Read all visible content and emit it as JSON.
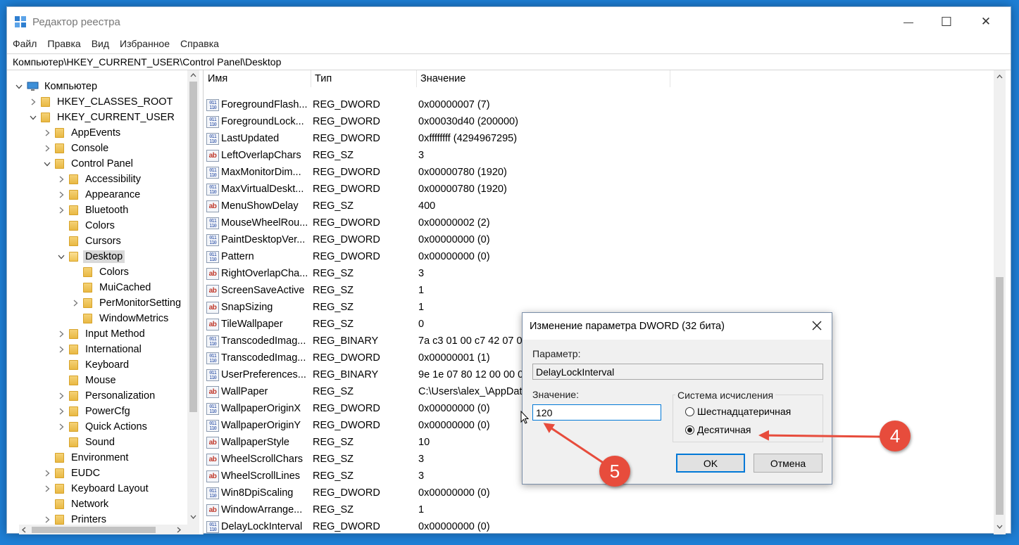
{
  "window": {
    "title": "Редактор реестра",
    "minimize_glyph": "—",
    "maximize_glyph": "☐",
    "close_glyph": "✕"
  },
  "menu": [
    "Файл",
    "Правка",
    "Вид",
    "Избранное",
    "Справка"
  ],
  "address": "Компьютер\\HKEY_CURRENT_USER\\Control Panel\\Desktop",
  "tree": [
    {
      "label": "Компьютер",
      "level": 0,
      "expander": "v",
      "icon": "computer-icon"
    },
    {
      "label": "HKEY_CLASSES_ROOT",
      "level": 1,
      "expander": ">",
      "icon": "folder-icon"
    },
    {
      "label": "HKEY_CURRENT_USER",
      "level": 1,
      "expander": "v",
      "icon": "folder-icon"
    },
    {
      "label": "AppEvents",
      "level": 2,
      "expander": ">",
      "icon": "folder-icon"
    },
    {
      "label": "Console",
      "level": 2,
      "expander": ">",
      "icon": "folder-icon"
    },
    {
      "label": "Control Panel",
      "level": 2,
      "expander": "v",
      "icon": "folder-icon"
    },
    {
      "label": "Accessibility",
      "level": 3,
      "expander": ">",
      "icon": "folder-icon"
    },
    {
      "label": "Appearance",
      "level": 3,
      "expander": ">",
      "icon": "folder-icon"
    },
    {
      "label": "Bluetooth",
      "level": 3,
      "expander": ">",
      "icon": "folder-icon"
    },
    {
      "label": "Colors",
      "level": 3,
      "expander": "",
      "icon": "folder-icon"
    },
    {
      "label": "Cursors",
      "level": 3,
      "expander": "",
      "icon": "folder-icon"
    },
    {
      "label": "Desktop",
      "level": 3,
      "expander": "v",
      "icon": "folder-open-icon",
      "selected": true
    },
    {
      "label": "Colors",
      "level": 4,
      "expander": "",
      "icon": "folder-icon"
    },
    {
      "label": "MuiCached",
      "level": 4,
      "expander": "",
      "icon": "folder-icon"
    },
    {
      "label": "PerMonitorSetting",
      "level": 4,
      "expander": ">",
      "icon": "folder-icon"
    },
    {
      "label": "WindowMetrics",
      "level": 4,
      "expander": "",
      "icon": "folder-icon"
    },
    {
      "label": "Input Method",
      "level": 3,
      "expander": ">",
      "icon": "folder-icon"
    },
    {
      "label": "International",
      "level": 3,
      "expander": ">",
      "icon": "folder-icon"
    },
    {
      "label": "Keyboard",
      "level": 3,
      "expander": "",
      "icon": "folder-icon"
    },
    {
      "label": "Mouse",
      "level": 3,
      "expander": "",
      "icon": "folder-icon"
    },
    {
      "label": "Personalization",
      "level": 3,
      "expander": ">",
      "icon": "folder-icon"
    },
    {
      "label": "PowerCfg",
      "level": 3,
      "expander": ">",
      "icon": "folder-icon"
    },
    {
      "label": "Quick Actions",
      "level": 3,
      "expander": ">",
      "icon": "folder-icon"
    },
    {
      "label": "Sound",
      "level": 3,
      "expander": "",
      "icon": "folder-icon"
    },
    {
      "label": "Environment",
      "level": 2,
      "expander": "",
      "icon": "folder-icon"
    },
    {
      "label": "EUDC",
      "level": 2,
      "expander": ">",
      "icon": "folder-icon"
    },
    {
      "label": "Keyboard Layout",
      "level": 2,
      "expander": ">",
      "icon": "folder-icon"
    },
    {
      "label": "Network",
      "level": 2,
      "expander": "",
      "icon": "folder-icon"
    },
    {
      "label": "Printers",
      "level": 2,
      "expander": ">",
      "icon": "folder-icon"
    }
  ],
  "columns": {
    "name": "Имя",
    "type": "Тип",
    "value": "Значение"
  },
  "values": [
    {
      "icon": "dword",
      "name": "ForegroundFlash...",
      "type": "REG_DWORD",
      "data": "0x00000007 (7)"
    },
    {
      "icon": "dword",
      "name": "ForegroundLock...",
      "type": "REG_DWORD",
      "data": "0x00030d40 (200000)"
    },
    {
      "icon": "dword",
      "name": "LastUpdated",
      "type": "REG_DWORD",
      "data": "0xffffffff (4294967295)"
    },
    {
      "icon": "sz",
      "name": "LeftOverlapChars",
      "type": "REG_SZ",
      "data": "3"
    },
    {
      "icon": "dword",
      "name": "MaxMonitorDim...",
      "type": "REG_DWORD",
      "data": "0x00000780 (1920)"
    },
    {
      "icon": "dword",
      "name": "MaxVirtualDeskt...",
      "type": "REG_DWORD",
      "data": "0x00000780 (1920)"
    },
    {
      "icon": "sz",
      "name": "MenuShowDelay",
      "type": "REG_SZ",
      "data": "400"
    },
    {
      "icon": "dword",
      "name": "MouseWheelRou...",
      "type": "REG_DWORD",
      "data": "0x00000002 (2)"
    },
    {
      "icon": "dword",
      "name": "PaintDesktopVer...",
      "type": "REG_DWORD",
      "data": "0x00000000 (0)"
    },
    {
      "icon": "dword",
      "name": "Pattern",
      "type": "REG_DWORD",
      "data": "0x00000000 (0)"
    },
    {
      "icon": "sz",
      "name": "RightOverlapCha...",
      "type": "REG_SZ",
      "data": "3"
    },
    {
      "icon": "sz",
      "name": "ScreenSaveActive",
      "type": "REG_SZ",
      "data": "1"
    },
    {
      "icon": "sz",
      "name": "SnapSizing",
      "type": "REG_SZ",
      "data": "1"
    },
    {
      "icon": "sz",
      "name": "TileWallpaper",
      "type": "REG_SZ",
      "data": "0"
    },
    {
      "icon": "dword",
      "name": "TranscodedImag...",
      "type": "REG_BINARY",
      "data": "7a c3 01 00 c7 42 07 00"
    },
    {
      "icon": "dword",
      "name": "TranscodedImag...",
      "type": "REG_DWORD",
      "data": "0x00000001 (1)"
    },
    {
      "icon": "dword",
      "name": "UserPreferences...",
      "type": "REG_BINARY",
      "data": "9e 1e 07 80 12 00 00 00"
    },
    {
      "icon": "sz",
      "name": "WallPaper",
      "type": "REG_SZ",
      "data": "C:\\Users\\alex_\\AppDat"
    },
    {
      "icon": "dword",
      "name": "WallpaperOriginX",
      "type": "REG_DWORD",
      "data": "0x00000000 (0)"
    },
    {
      "icon": "dword",
      "name": "WallpaperOriginY",
      "type": "REG_DWORD",
      "data": "0x00000000 (0)"
    },
    {
      "icon": "sz",
      "name": "WallpaperStyle",
      "type": "REG_SZ",
      "data": "10"
    },
    {
      "icon": "sz",
      "name": "WheelScrollChars",
      "type": "REG_SZ",
      "data": "3"
    },
    {
      "icon": "sz",
      "name": "WheelScrollLines",
      "type": "REG_SZ",
      "data": "3"
    },
    {
      "icon": "dword",
      "name": "Win8DpiScaling",
      "type": "REG_DWORD",
      "data": "0x00000000 (0)"
    },
    {
      "icon": "sz",
      "name": "WindowArrange...",
      "type": "REG_SZ",
      "data": "1"
    },
    {
      "icon": "dword",
      "name": "DelayLockInterval",
      "type": "REG_DWORD",
      "data": "0x00000000 (0)"
    }
  ],
  "icon_text": {
    "dword": "011\n110",
    "sz": "ab"
  },
  "dialog": {
    "title": "Изменение параметра DWORD (32 бита)",
    "param_label": "Параметр:",
    "param_value": "DelayLockInterval",
    "value_label": "Значение:",
    "value_input": "120",
    "base_group": "Система исчисления",
    "radio_hex": "Шестнадцатеричная",
    "radio_dec": "Десятичная",
    "ok": "OK",
    "cancel": "Отмена",
    "selected_base": "dec"
  },
  "annotations": {
    "badge_4": "4",
    "badge_5": "5",
    "color": "#e74c3c"
  },
  "colors": {
    "desktop": "#1e7fd6",
    "selection": "#d9d9d9",
    "focus": "#0078d7"
  }
}
